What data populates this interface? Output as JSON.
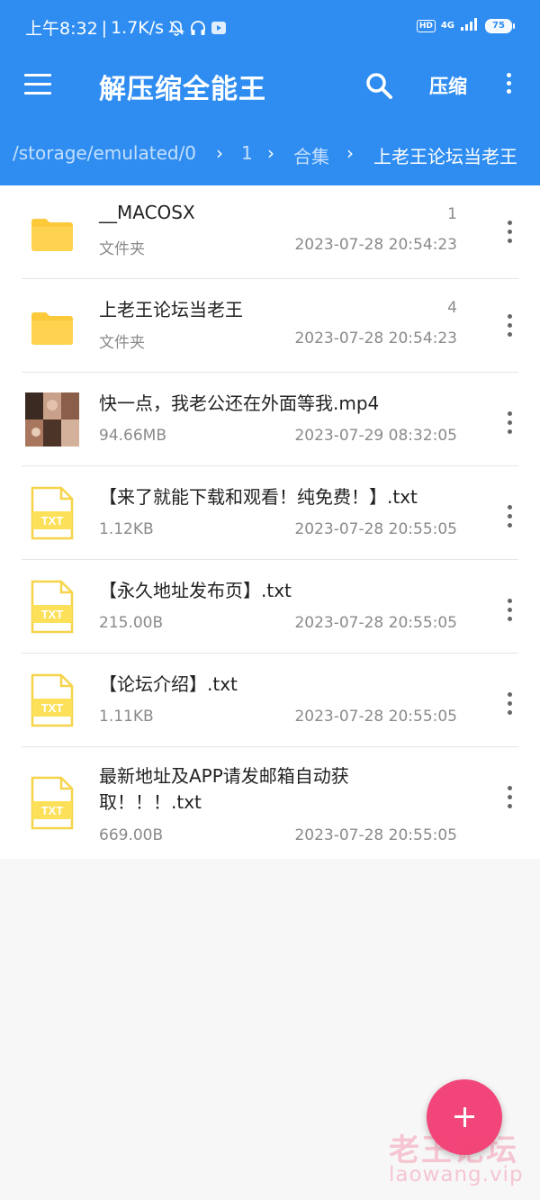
{
  "status_bar": {
    "time": "上午8:32",
    "speed": "1.7K/s",
    "hd": "HD",
    "network": "4G",
    "battery": "75"
  },
  "app_bar": {
    "title": "解压缩全能王",
    "compress_label": "压缩"
  },
  "breadcrumbs": [
    "/storage/emulated/0",
    "1",
    "合集",
    "上老王论坛当老王"
  ],
  "files": [
    {
      "name": "__MACOSX",
      "type": "folder",
      "sub": "文件夹",
      "count": "1",
      "date": "2023-07-28 20:54:23"
    },
    {
      "name": "上老王论坛当老王",
      "type": "folder",
      "sub": "文件夹",
      "count": "4",
      "date": "2023-07-28 20:54:23"
    },
    {
      "name": "快一点，我老公还在外面等我.mp4",
      "type": "video",
      "sub": "94.66MB",
      "count": "",
      "date": "2023-07-29 08:32:05"
    },
    {
      "name": "【来了就能下载和观看！纯免费！】.txt",
      "type": "txt",
      "sub": "1.12KB",
      "count": "",
      "date": "2023-07-28 20:55:05"
    },
    {
      "name": "【永久地址发布页】.txt",
      "type": "txt",
      "sub": "215.00B",
      "count": "",
      "date": "2023-07-28 20:55:05"
    },
    {
      "name": "【论坛介绍】.txt",
      "type": "txt",
      "sub": "1.11KB",
      "count": "",
      "date": "2023-07-28 20:55:05"
    },
    {
      "name": "最新地址及APP请发邮箱自动获取！！！.txt",
      "type": "txt",
      "sub": "669.00B",
      "count": "",
      "date": "2023-07-28 20:55:05"
    }
  ],
  "icons": {
    "txt_label": "TXT"
  },
  "watermark": {
    "line1": "老王论坛",
    "line2": "laowang.vip"
  },
  "colors": {
    "primary": "#2f8df2",
    "fab": "#f2467a",
    "folder": "#fcc93a"
  }
}
